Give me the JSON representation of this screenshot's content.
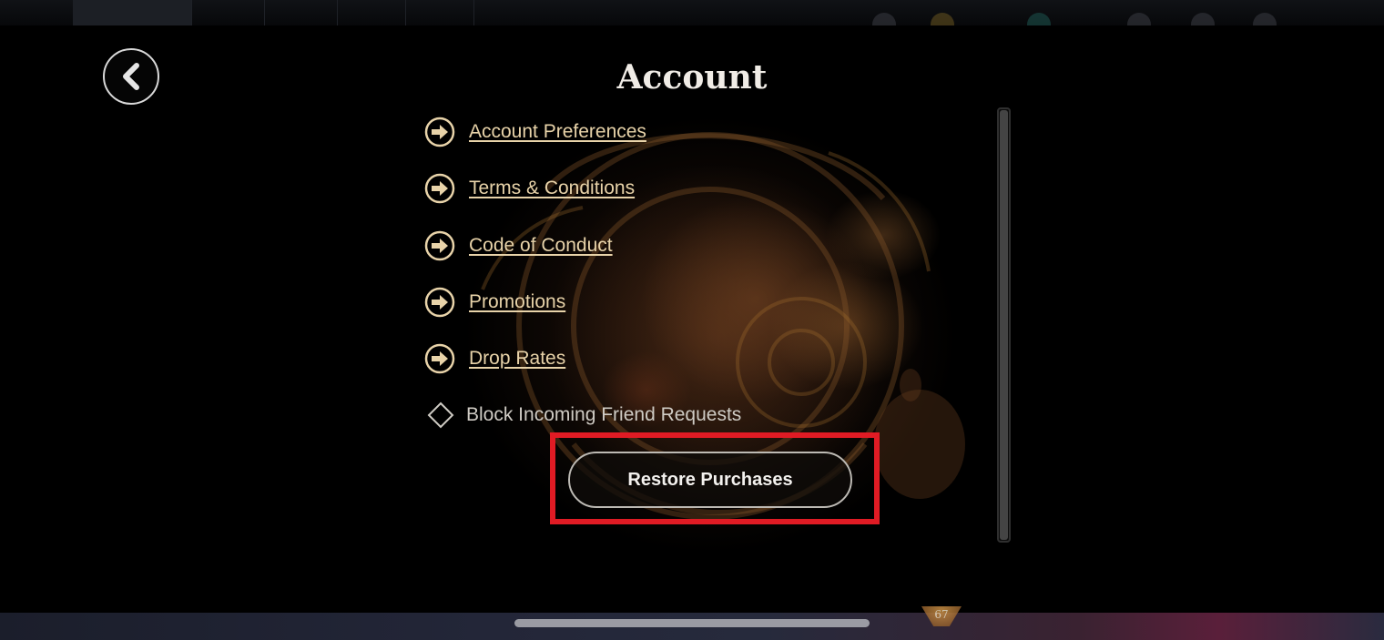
{
  "header": {
    "title": "Account"
  },
  "nav": {
    "back_icon": "chevron-left-icon"
  },
  "menu": {
    "items": [
      {
        "label": "Account Preferences",
        "icon": "arrow-right-circle-icon"
      },
      {
        "label": "Terms & Conditions",
        "icon": "arrow-right-circle-icon"
      },
      {
        "label": "Code of Conduct",
        "icon": "arrow-right-circle-icon"
      },
      {
        "label": "Promotions",
        "icon": "arrow-right-circle-icon"
      },
      {
        "label": "Drop Rates",
        "icon": "arrow-right-circle-icon"
      }
    ]
  },
  "settings": {
    "block_friend_requests": {
      "label": "Block Incoming Friend Requests",
      "checked": false,
      "icon": "diamond-checkbox-icon"
    }
  },
  "actions": {
    "restore_label": "Restore Purchases"
  },
  "annotation": {
    "highlight_color": "#e01b24"
  },
  "colors": {
    "link": "#e8d3a9",
    "title": "#f0ece6",
    "background": "#000000"
  }
}
